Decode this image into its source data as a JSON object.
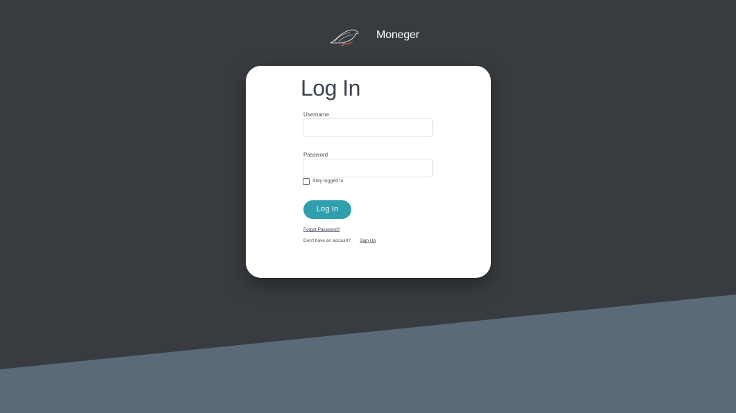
{
  "brand": {
    "name": "Moneger",
    "logo_icon": "bird-logo-icon"
  },
  "login_form": {
    "title": "Log In",
    "username": {
      "label": "Username",
      "value": "",
      "placeholder": ""
    },
    "password": {
      "label": "Password",
      "value": "",
      "placeholder": ""
    },
    "stay_logged_in": {
      "label": "Stay logged in",
      "checked": false
    },
    "submit_label": "Log In",
    "forgot_password_label": "Forgot Password?",
    "signup_prompt": "Don't have an account?",
    "signup_link_label": "Sign Up"
  },
  "colors": {
    "background_dark": "#383c40",
    "background_slant": "#5a6a78",
    "card": "#ffffff",
    "accent": "#2f9fae",
    "logo_accent": "#e0523c"
  }
}
